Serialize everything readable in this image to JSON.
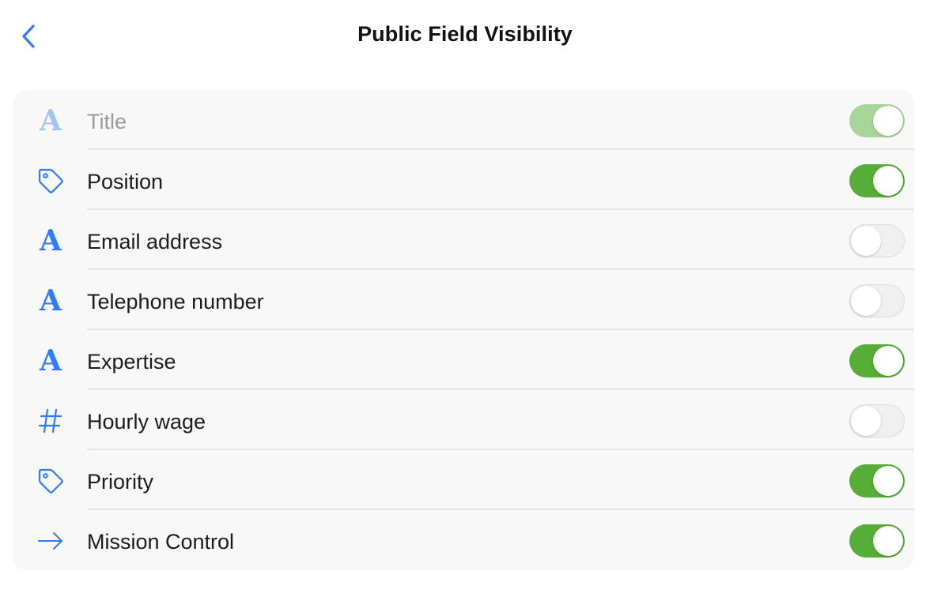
{
  "nav": {
    "title": "Public Field Visibility",
    "back_icon": "chevron-left-icon",
    "accent_color": "#2f7df6"
  },
  "fields": [
    {
      "key": "title",
      "label": "Title",
      "icon": "text-a-icon",
      "enabled": true,
      "disabled": true
    },
    {
      "key": "position",
      "label": "Position",
      "icon": "tag-icon",
      "enabled": true,
      "disabled": false
    },
    {
      "key": "email",
      "label": "Email address",
      "icon": "text-a-icon",
      "enabled": false,
      "disabled": false
    },
    {
      "key": "telephone",
      "label": "Telephone number",
      "icon": "text-a-icon",
      "enabled": false,
      "disabled": false
    },
    {
      "key": "expertise",
      "label": "Expertise",
      "icon": "text-a-icon",
      "enabled": true,
      "disabled": false
    },
    {
      "key": "hourly_wage",
      "label": "Hourly wage",
      "icon": "hash-icon",
      "enabled": false,
      "disabled": false
    },
    {
      "key": "priority",
      "label": "Priority",
      "icon": "tag-icon",
      "enabled": true,
      "disabled": false
    },
    {
      "key": "mission_control",
      "label": "Mission Control",
      "icon": "arrow-right-icon",
      "enabled": true,
      "disabled": false
    }
  ],
  "colors": {
    "toggle_on": "#56ad37",
    "toggle_on_disabled": "#a8d69a",
    "toggle_off": "#f0f0f0",
    "icon_blue": "#2f7df6"
  }
}
